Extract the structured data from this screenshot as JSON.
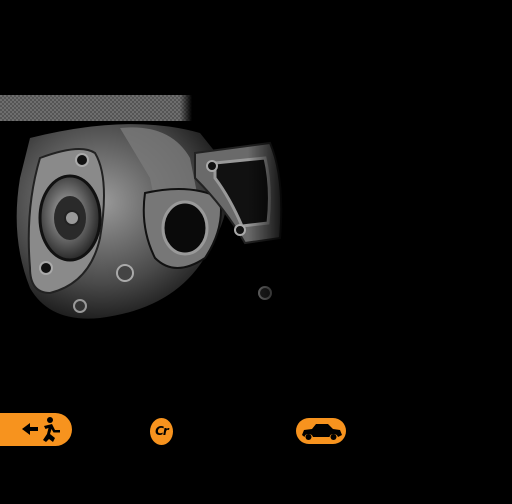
{
  "page": {
    "background_color": "#000000",
    "accent_color": "#f7931e"
  },
  "header_strip": {
    "pattern": "checkered-grey"
  },
  "hero_image": {
    "subject": "turbocharger",
    "tone": "black-and-white"
  },
  "nav": {
    "exit_button": {
      "icon": "exit-arrow-person-icon"
    },
    "cr_button": {
      "label": "Cr",
      "icon": "cr-logo-icon"
    },
    "car_button": {
      "icon": "car-icon"
    }
  }
}
